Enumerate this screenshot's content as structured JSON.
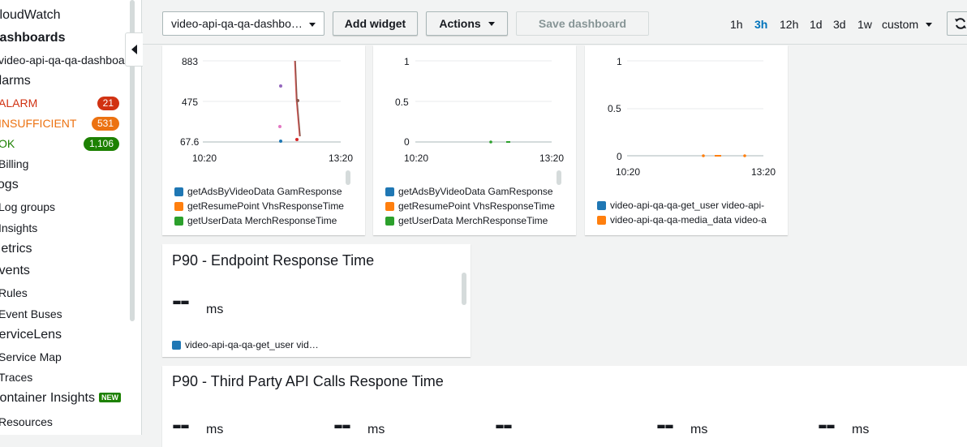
{
  "sidebar": {
    "app_title": "CloudWatch",
    "dashboards": "Dashboards",
    "current_dashboard": "video-api-qa-qa-dashboard",
    "alarms": "Alarms",
    "alarm_states": [
      {
        "label": "ALARM",
        "count": "21",
        "color": "#d13212",
        "badge": "#d13212"
      },
      {
        "label": "INSUFFICIENT",
        "count": "531",
        "color": "#ec7211",
        "badge": "#ec7211"
      },
      {
        "label": "OK",
        "count": "1,106",
        "color": "#1d8102",
        "badge": "#1d8102"
      }
    ],
    "billing": "Billing",
    "logs": "Logs",
    "log_groups": "Log groups",
    "insights": "Insights",
    "metrics": "Metrics",
    "events": "Events",
    "rules": "Rules",
    "event_buses": "Event Buses",
    "servicelens": "ServiceLens",
    "service_map": "Service Map",
    "traces": "Traces",
    "container_insights": "Container Insights",
    "new_badge": "NEW",
    "resources": "Resources"
  },
  "toolbar": {
    "dashboard_select": "video-api-qa-qa-dashbo…",
    "add_widget": "Add widget",
    "actions": "Actions",
    "save_dashboard": "Save dashboard",
    "time_ranges": [
      "1h",
      "3h",
      "12h",
      "1d",
      "3d",
      "1w"
    ],
    "active_range": "3h",
    "custom": "custom"
  },
  "widgets": {
    "w1": {
      "y_ticks": [
        "883",
        "475",
        "67.6"
      ],
      "x_ticks": [
        "10:20",
        "13:20"
      ],
      "legend": [
        {
          "label": "getAdsByVideoData GamResponse",
          "color": "#1f77b4"
        },
        {
          "label": "getResumePoint VhsResponseTime",
          "color": "#ff7f0e"
        },
        {
          "label": "getUserData MerchResponseTime",
          "color": "#2ca02c"
        }
      ]
    },
    "w2": {
      "y_ticks": [
        "1",
        "0.5",
        "0"
      ],
      "x_ticks": [
        "10:20",
        "13:20"
      ],
      "legend": [
        {
          "label": "getAdsByVideoData GamResponse",
          "color": "#1f77b4"
        },
        {
          "label": "getResumePoint VhsResponseTime",
          "color": "#ff7f0e"
        },
        {
          "label": "getUserData MerchResponseTime",
          "color": "#2ca02c"
        }
      ]
    },
    "w3": {
      "y_ticks": [
        "1",
        "0.5",
        "0"
      ],
      "x_ticks": [
        "10:20",
        "13:20"
      ],
      "legend": [
        {
          "label": "video-api-qa-qa-get_user video-api-",
          "color": "#1f77b4"
        },
        {
          "label": "video-api-qa-qa-media_data video-a",
          "color": "#ff7f0e"
        }
      ]
    },
    "p90_endpoint": {
      "title": "P90 - Endpoint Response Time",
      "value": "--",
      "unit": "ms",
      "legend": [
        {
          "label": "video-api-qa-qa-get_user vid…",
          "color": "#1f77b4"
        }
      ]
    },
    "p90_third_party": {
      "title": "P90 - Third Party API Calls Respone Time",
      "values": [
        {
          "value": "--",
          "unit": "ms"
        },
        {
          "value": "--",
          "unit": "ms"
        },
        {
          "value": "--",
          "unit": ""
        },
        {
          "value": "--",
          "unit": "ms"
        },
        {
          "value": "--",
          "unit": "ms"
        }
      ]
    }
  },
  "icons": {
    "collapse": "chevron-left-icon",
    "refresh": "refresh-icon",
    "dropdown": "caret-down-icon"
  }
}
